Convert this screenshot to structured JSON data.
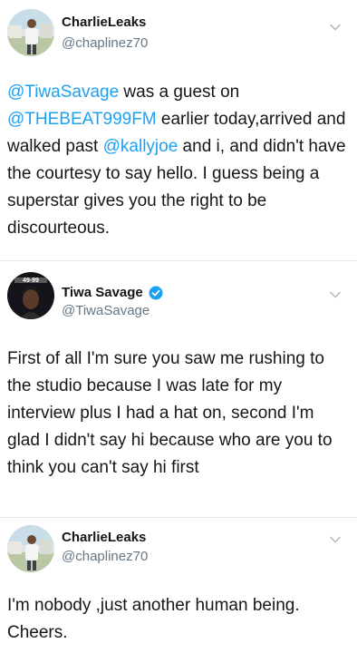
{
  "tweets": [
    {
      "display_name": "CharlieLeaks",
      "handle": "@chaplinez70",
      "verified": false,
      "avatar_icon": "user-photo-outdoors",
      "body_parts": [
        {
          "text": "@TiwaSavage",
          "type": "mention"
        },
        {
          "text": " was a guest on ",
          "type": "text"
        },
        {
          "text": "@THEBEAT999FM",
          "type": "mention"
        },
        {
          "text": " earlier today,arrived and walked past ",
          "type": "text"
        },
        {
          "text": "@kallyjoe",
          "type": "mention"
        },
        {
          "text": " and i, and didn't have the courtesy to say hello. I guess being a superstar gives you the right to be discourteous.",
          "type": "text"
        }
      ]
    },
    {
      "display_name": "Tiwa Savage",
      "handle": "@TiwaSavage",
      "verified": true,
      "avatar_icon": "user-photo-portrait",
      "avatar_badge_text": "49-99",
      "body_parts": [
        {
          "text": "First of all I'm sure you saw me rushing to the studio because I was late for my interview plus I had a hat on, second I'm glad I didn't say hi because who are you to think you can't say hi first",
          "type": "text"
        }
      ]
    },
    {
      "display_name": "CharlieLeaks",
      "handle": "@chaplinez70",
      "verified": false,
      "avatar_icon": "user-photo-outdoors",
      "body_parts": [
        {
          "text": "I'm nobody ,just another human being. Cheers.",
          "type": "text"
        }
      ]
    }
  ],
  "colors": {
    "mention": "#1da1f2",
    "text": "#14171a",
    "secondary": "#657786",
    "divider": "#e1e8ed",
    "verified": "#1da1f2"
  }
}
